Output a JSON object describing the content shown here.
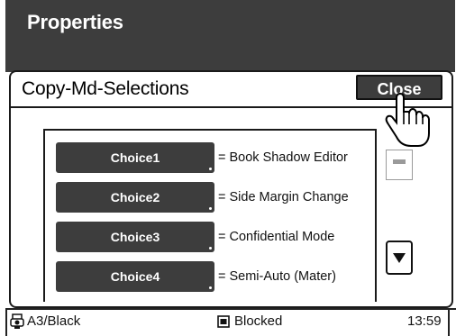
{
  "header": {
    "title": "Properties"
  },
  "panel": {
    "title": "Copy-Md-Selections",
    "close_label": "Close"
  },
  "choices": [
    {
      "label": "Choice1",
      "description": "= Book Shadow Editor"
    },
    {
      "label": "Choice2",
      "description": "= Side Margin Change"
    },
    {
      "label": "Choice3",
      "description": "= Confidential Mode"
    },
    {
      "label": "Choice4",
      "description": "= Semi-Auto (Mater)"
    }
  ],
  "status": {
    "paper": "A3/Black",
    "state": "Blocked",
    "time": "13:59"
  },
  "icons": {
    "hand": "pointing-hand-icon",
    "scroll_up": "scroll-up-icon",
    "scroll_down": "scroll-down-icon",
    "paper": "paper-tray-icon",
    "blocked": "blocked-icon"
  },
  "colors": {
    "header_bg": "#3d3d3d",
    "button_bg": "#3d3d3d",
    "text_light": "#ffffff"
  }
}
